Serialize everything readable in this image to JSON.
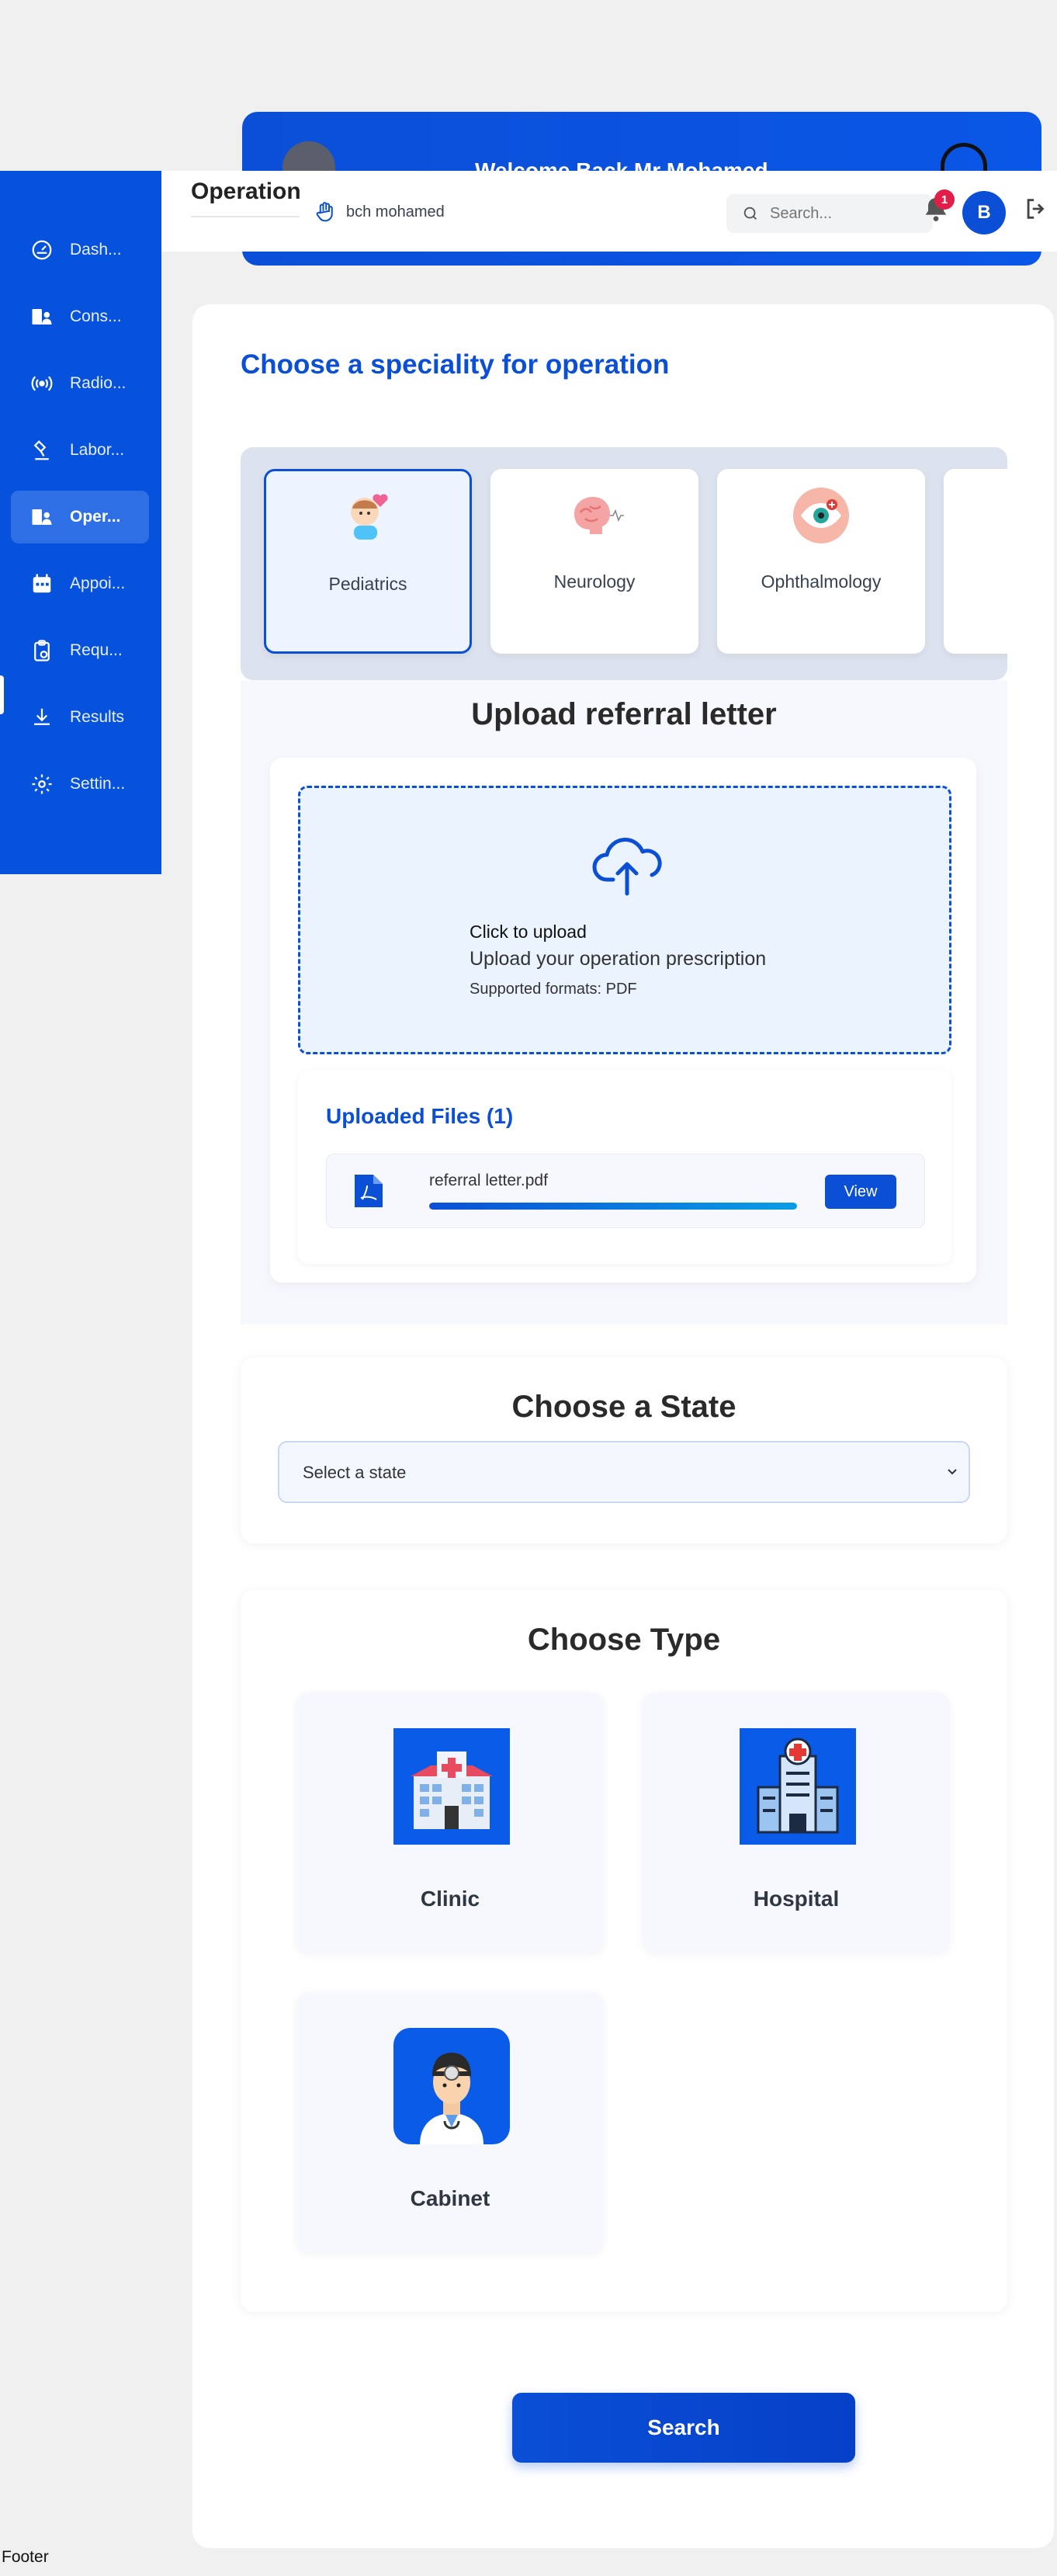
{
  "welcome": {
    "text": "Welcome Back Mr Mohamed"
  },
  "sidebar": {
    "items": [
      {
        "label": "Dash...",
        "icon": "dashboard-icon"
      },
      {
        "label": "Cons...",
        "icon": "consultation-icon"
      },
      {
        "label": "Radio...",
        "icon": "radiology-icon"
      },
      {
        "label": "Labor...",
        "icon": "laboratory-icon"
      },
      {
        "label": "Oper...",
        "icon": "operation-icon",
        "active": true
      },
      {
        "label": "Appoi...",
        "icon": "calendar-icon"
      },
      {
        "label": "Requ...",
        "icon": "clipboard-icon"
      },
      {
        "label": "Results",
        "icon": "download-icon"
      },
      {
        "label": "Settin...",
        "icon": "gear-icon"
      }
    ]
  },
  "header": {
    "title": "Operation",
    "user_name": "bch mohamed",
    "search_placeholder": "Search...",
    "notification_count": "1",
    "avatar_initial": "B"
  },
  "main": {
    "speciality_heading": "Choose a speciality for operation",
    "specialities": [
      {
        "label": "Pediatrics",
        "selected": true
      },
      {
        "label": "Neurology"
      },
      {
        "label": "Ophthalmology"
      }
    ],
    "upload": {
      "heading": "Upload referral letter",
      "click_text": "Click to upload",
      "sub_text": "Upload your operation prescription",
      "formats": "Supported formats: PDF",
      "files_title": "Uploaded Files (1)",
      "file_name": "referral letter.pdf",
      "progress_percent": 100,
      "view_label": "View"
    },
    "state": {
      "heading": "Choose a State",
      "placeholder": "Select a state"
    },
    "type": {
      "heading": "Choose Type",
      "options": [
        {
          "label": "Clinic",
          "icon": "clinic-icon"
        },
        {
          "label": "Hospital",
          "icon": "hospital-icon"
        },
        {
          "label": "Cabinet",
          "icon": "doctor-icon"
        }
      ]
    },
    "search_button": "Search"
  },
  "footer": {
    "text": "Footer"
  },
  "colors": {
    "primary": "#0a4fd6",
    "sidebar": "#0652dd",
    "badge": "#e11d48"
  }
}
